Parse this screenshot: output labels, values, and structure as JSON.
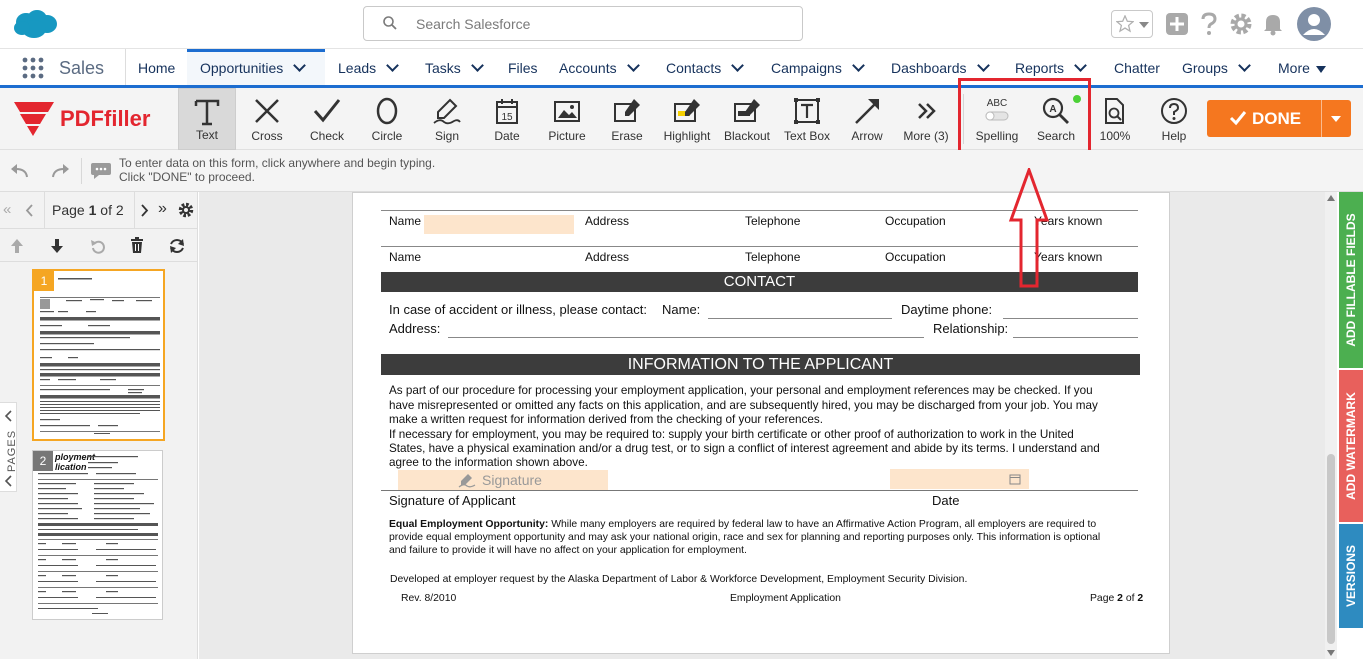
{
  "header": {
    "search_placeholder": "Search Salesforce"
  },
  "nav": {
    "app_name": "Sales",
    "items": [
      "Home",
      "Opportunities",
      "Leads",
      "Tasks",
      "Files",
      "Accounts",
      "Contacts",
      "Campaigns",
      "Dashboards",
      "Reports",
      "Chatter",
      "Groups",
      "More"
    ]
  },
  "toolbar": {
    "brand": "PDFfiller",
    "tools": [
      "Text",
      "Cross",
      "Check",
      "Circle",
      "Sign",
      "Date",
      "Picture",
      "Erase",
      "Highlight",
      "Blackout",
      "Text Box",
      "Arrow",
      "More (3)",
      "Spelling",
      "Search",
      "100%",
      "Help"
    ],
    "spelling_icon_text": "ABC",
    "date_icon_text": "15",
    "done_label": "DONE"
  },
  "hint": {
    "line1": "To enter data on this form, click anywhere and begin typing.",
    "line2": "Click \"DONE\" to proceed."
  },
  "pages": {
    "page_label": "Page",
    "current": "1",
    "of_label": "of 2",
    "side_label": "PAGES",
    "thumb1_num": "1",
    "thumb2_num": "2",
    "thumb2_title_1": "ployment",
    "thumb2_title_2": "lication"
  },
  "document": {
    "ref_rows": [
      {
        "name": "Name",
        "address": "Address",
        "telephone": "Telephone",
        "occupation": "Occupation",
        "years": "Years known"
      },
      {
        "name": "Name",
        "address": "Address",
        "telephone": "Telephone",
        "occupation": "Occupation",
        "years": "Years known"
      }
    ],
    "contact_heading": "CONTACT",
    "contact_line1": "In case of accident or illness, please contact:",
    "contact_name": "Name:",
    "contact_phone": "Daytime phone:",
    "contact_address": "Address:",
    "contact_relationship": "Relationship:",
    "info_heading": "INFORMATION TO THE APPLICANT",
    "para1": [
      "As part of our procedure for processing your employment application, your personal and employment references may be checked. If you",
      "have misrepresented or omitted any facts on this application, and are subsequently hired, you may be discharged from your job. You may",
      "make a written request for information derived from the checking of your references."
    ],
    "para2": [
      "If necessary for employment, you may be required to: supply your birth certificate or other proof of authorization to work in the United",
      "States, have a physical examination and/or a drug test, or to sign a conflict of interest agreement and abide by its terms. I understand and",
      "agree to the information shown above."
    ],
    "signature_placeholder": "Signature",
    "signature_label": "Signature of Applicant",
    "date_label": "Date",
    "eeo_bold": "Equal Employment Opportunity:",
    "eeo_lines": [
      " While many employers are required by federal law to have an Affirmative Action Program, all employers are required to",
      "provide equal employment opportunity and may ask your national origin, race and sex for planning and reporting purposes only. This information is optional",
      "and failure to provide it will have no affect on your application for employment."
    ],
    "developed": "Developed at employer request by the Alaska Department of Labor & Workforce Development, Employment Security Division.",
    "rev": "Rev. 8/2010",
    "footer_center": "Employment Application",
    "footer_page": "Page",
    "footer_page_num": "2",
    "footer_of": "of",
    "footer_total": "2"
  },
  "right_tabs": [
    "ADD FILLABLE FIELDS",
    "ADD WATERMARK",
    "VERSIONS"
  ],
  "colors": {
    "salesforce_blue": "#1798c1",
    "done_orange": "#f5771f",
    "highlight_red": "#e3262f",
    "fields_green": "#4caf50",
    "watermark_red": "#e8605c",
    "versions_blue": "#2e8bc0"
  }
}
